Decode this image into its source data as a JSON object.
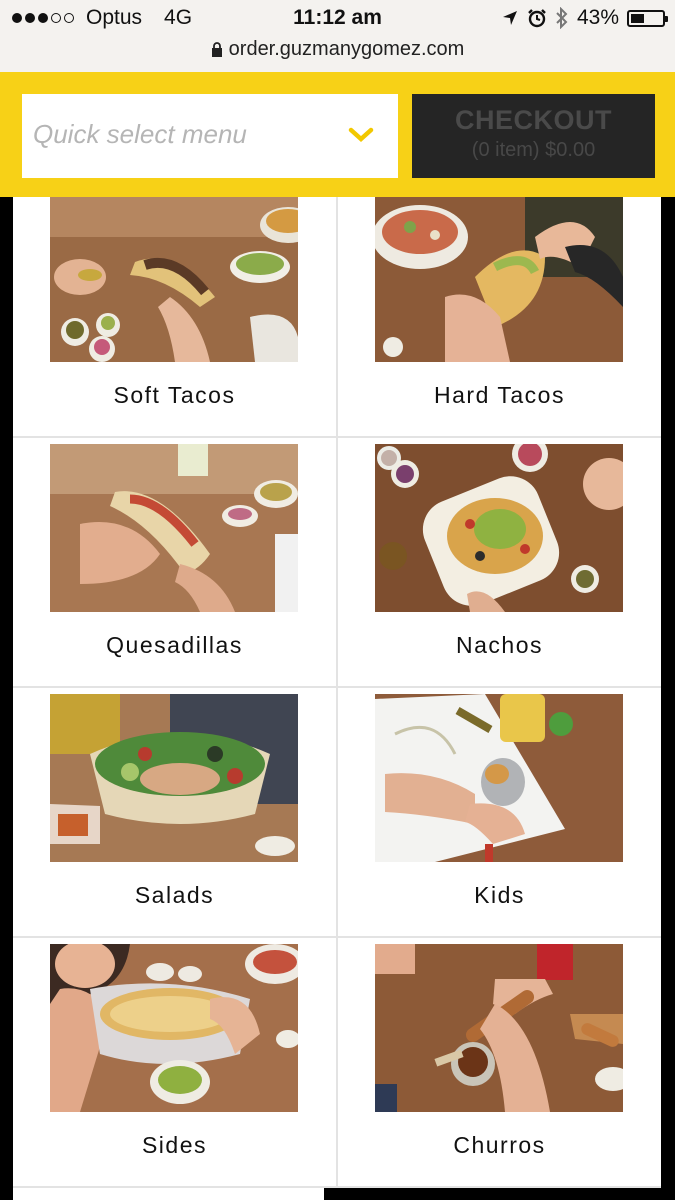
{
  "status_bar": {
    "carrier": "Optus",
    "network": "4G",
    "time": "11:12 am",
    "battery": "43%",
    "battery_level": 0.43,
    "signal_bars_filled": 3,
    "signal_bars_total": 5,
    "icons": [
      "location-arrow-icon",
      "alarm-icon",
      "bluetooth-icon",
      "battery-icon"
    ]
  },
  "url_bar": {
    "url": "order.guzmanygomez.com",
    "icon": "lock-icon"
  },
  "header": {
    "background_color": "#f7d117",
    "quick_select": {
      "placeholder": "Quick select menu",
      "icon": "chevron-down-icon"
    },
    "checkout": {
      "label": "CHECKOUT",
      "summary": "(0 item) $0.00"
    }
  },
  "menu": {
    "items": [
      {
        "label": "Soft Tacos",
        "image": "soft-tacos-photo"
      },
      {
        "label": "Hard Tacos",
        "image": "hard-tacos-photo"
      },
      {
        "label": "Quesadillas",
        "image": "quesadillas-photo"
      },
      {
        "label": "Nachos",
        "image": "nachos-photo"
      },
      {
        "label": "Salads",
        "image": "salads-photo"
      },
      {
        "label": "Kids",
        "image": "kids-photo"
      },
      {
        "label": "Sides",
        "image": "sides-photo"
      },
      {
        "label": "Churros",
        "image": "churros-photo"
      }
    ]
  }
}
